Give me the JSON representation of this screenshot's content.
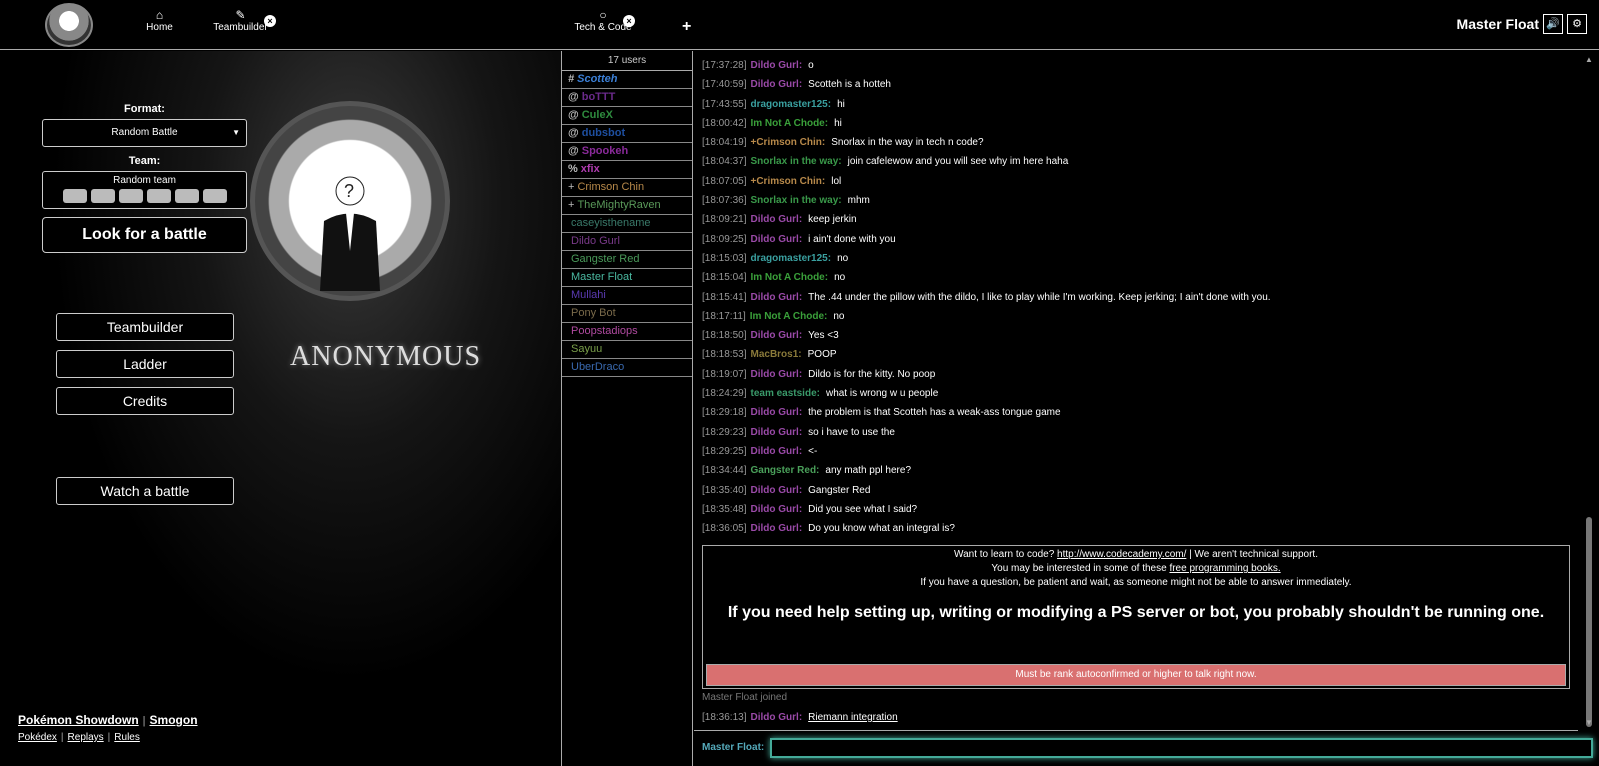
{
  "header": {
    "tabs": [
      {
        "label": "Home",
        "icon": "home-icon"
      },
      {
        "label": "Teambuilder",
        "icon": "edit-icon"
      },
      {
        "label": "Tech & Code",
        "icon": "chat-bubble-icon"
      }
    ],
    "plus": "+",
    "username": "Master Float",
    "sound_icon": "🔊",
    "settings_icon": "⚙"
  },
  "main": {
    "format_label": "Format:",
    "format_value": "Random Battle",
    "team_label": "Team:",
    "team_value": "Random team",
    "look_battle": "Look for a battle",
    "teambuilder": "Teambuilder",
    "ladder": "Ladder",
    "credits": "Credits",
    "watch_battle": "Watch a battle",
    "logo_text": "ANONYMOUS"
  },
  "footer": {
    "showdown": "Pokémon Showdown",
    "smogon": "Smogon",
    "pokedex": "Pokédex",
    "replays": "Replays",
    "rules": "Rules",
    "sep": "|"
  },
  "userlist": {
    "count": "17 users",
    "users": [
      {
        "group": "#",
        "name": "Scotteh",
        "color": "#3b7fd6",
        "bold": true,
        "italic": true
      },
      {
        "group": "@",
        "name": "boTTT",
        "color": "#6a2a8a",
        "bold": true,
        "italic": false
      },
      {
        "group": "@",
        "name": "CuleX",
        "color": "#2e8b3e",
        "bold": true,
        "italic": false
      },
      {
        "group": "@",
        "name": "dubsbot",
        "color": "#1e4fa0",
        "bold": true,
        "italic": false
      },
      {
        "group": "@",
        "name": "Spookeh",
        "color": "#8a2a9a",
        "bold": true,
        "italic": false
      },
      {
        "group": "%",
        "name": "xfix",
        "color": "#b03cb0",
        "bold": true,
        "italic": false
      },
      {
        "group": "+",
        "name": "Crimson Chin",
        "color": "#b7894a",
        "bold": false,
        "italic": false
      },
      {
        "group": "+",
        "name": "TheMightyRaven",
        "color": "#5a9a5a",
        "bold": false,
        "italic": false
      },
      {
        "group": "",
        "name": "caseyisthename",
        "color": "#3a7a6a",
        "bold": false,
        "italic": false
      },
      {
        "group": "",
        "name": "Dildo Gurl",
        "color": "#7a3a8a",
        "bold": false,
        "italic": false
      },
      {
        "group": "",
        "name": "Gangster Red",
        "color": "#4a9a5a",
        "bold": false,
        "italic": false
      },
      {
        "group": "",
        "name": "Master Float",
        "color": "#4ab8a0",
        "bold": false,
        "italic": false
      },
      {
        "group": "",
        "name": "Mullahi",
        "color": "#5a3ab0",
        "bold": false,
        "italic": false
      },
      {
        "group": "",
        "name": "Pony Bot",
        "color": "#7a6a4a",
        "bold": false,
        "italic": false
      },
      {
        "group": "",
        "name": "Poopstadiops",
        "color": "#b04aa0",
        "bold": false,
        "italic": false
      },
      {
        "group": "",
        "name": "Sayuu",
        "color": "#7aa04a",
        "bold": false,
        "italic": false
      },
      {
        "group": "",
        "name": "UberDraco",
        "color": "#3a6ab0",
        "bold": false,
        "italic": false
      }
    ]
  },
  "chat": {
    "messages": [
      {
        "time": "[17:37:28]",
        "name": "Dildo Gurl:",
        "color": "#9a4aa8",
        "text": "o"
      },
      {
        "time": "[17:40:59]",
        "name": "Dildo Gurl:",
        "color": "#9a4aa8",
        "text": "Scotteh is a hotteh"
      },
      {
        "time": "[17:43:55]",
        "name": "dragomaster125:",
        "color": "#3aa0a0",
        "text": "hi"
      },
      {
        "time": "[18:00:42]",
        "name": "Im Not A Chode:",
        "color": "#3aa03a",
        "text": "hi"
      },
      {
        "time": "[18:04:19]",
        "name": "+Crimson Chin:",
        "color": "#b7894a",
        "text": "Snorlax in the way in tech n code?"
      },
      {
        "time": "[18:04:37]",
        "name": "Snorlax in the way:",
        "color": "#3a9a4a",
        "text": "join cafelewow and you will see why im here haha"
      },
      {
        "time": "[18:07:05]",
        "name": "+Crimson Chin:",
        "color": "#b7894a",
        "text": "lol"
      },
      {
        "time": "[18:07:36]",
        "name": "Snorlax in the way:",
        "color": "#3a9a4a",
        "text": "mhm"
      },
      {
        "time": "[18:09:21]",
        "name": "Dildo Gurl:",
        "color": "#9a4aa8",
        "text": "keep jerkin"
      },
      {
        "time": "[18:09:25]",
        "name": "Dildo Gurl:",
        "color": "#9a4aa8",
        "text": "i ain't done with you"
      },
      {
        "time": "[18:15:03]",
        "name": "dragomaster125:",
        "color": "#3aa0a0",
        "text": "no"
      },
      {
        "time": "[18:15:04]",
        "name": "Im Not A Chode:",
        "color": "#3aa03a",
        "text": "no"
      },
      {
        "time": "[18:15:41]",
        "name": "Dildo Gurl:",
        "color": "#9a4aa8",
        "text": "The .44 under the pillow with the dildo, I like to play while I'm working. Keep jerking; I ain't done with you."
      },
      {
        "time": "[18:17:11]",
        "name": "Im Not A Chode:",
        "color": "#3aa03a",
        "text": "no"
      },
      {
        "time": "[18:18:50]",
        "name": "Dildo Gurl:",
        "color": "#9a4aa8",
        "text": "Yes <3"
      },
      {
        "time": "[18:18:53]",
        "name": "MacBros1:",
        "color": "#8a7a3a",
        "text": "POOP"
      },
      {
        "time": "[18:19:07]",
        "name": "Dildo Gurl:",
        "color": "#9a4aa8",
        "text": "Dildo is for the kitty. No poop"
      },
      {
        "time": "[18:24:29]",
        "name": "team eastside:",
        "color": "#3a9a6a",
        "text": "what is wrong w u people"
      },
      {
        "time": "[18:29:18]",
        "name": "Dildo Gurl:",
        "color": "#9a4aa8",
        "text": "the problem is that Scotteh has a weak-ass tongue game"
      },
      {
        "time": "[18:29:23]",
        "name": "Dildo Gurl:",
        "color": "#9a4aa8",
        "text": "so i have to use the"
      },
      {
        "time": "[18:29:25]",
        "name": "Dildo Gurl:",
        "color": "#9a4aa8",
        "text": "<-"
      },
      {
        "time": "[18:34:44]",
        "name": "Gangster Red:",
        "color": "#4aa05a",
        "text": "any math ppl here?"
      },
      {
        "time": "[18:35:40]",
        "name": "Dildo Gurl:",
        "color": "#9a4aa8",
        "text": "Gangster Red"
      },
      {
        "time": "[18:35:48]",
        "name": "Dildo Gurl:",
        "color": "#9a4aa8",
        "text": "Did you see what I said?"
      },
      {
        "time": "[18:36:05]",
        "name": "Dildo Gurl:",
        "color": "#9a4aa8",
        "text": "Do you know what an integral is?"
      }
    ],
    "infobox": {
      "line1_pre": "Want to learn to code?",
      "line1_link": "http://www.codecademy.com/",
      "line1_post": "| We aren't technical support.",
      "line2_pre": "You may be interested in some of these",
      "line2_link": "free programming books.",
      "line3": "If you have a question, be patient and wait, as someone might not be able to answer immediately.",
      "big": "If you need help setting up, writing or modifying a PS server or bot, you probably shouldn't be running one."
    },
    "rank_warning": "Must be rank autoconfirmed or higher to talk right now.",
    "joined": "Master Float joined",
    "last": {
      "time": "[18:36:13]",
      "name": "Dildo Gurl:",
      "color": "#9a4aa8",
      "text": "Riemann integration"
    },
    "input_name": "Master Float:",
    "input_value": ""
  }
}
